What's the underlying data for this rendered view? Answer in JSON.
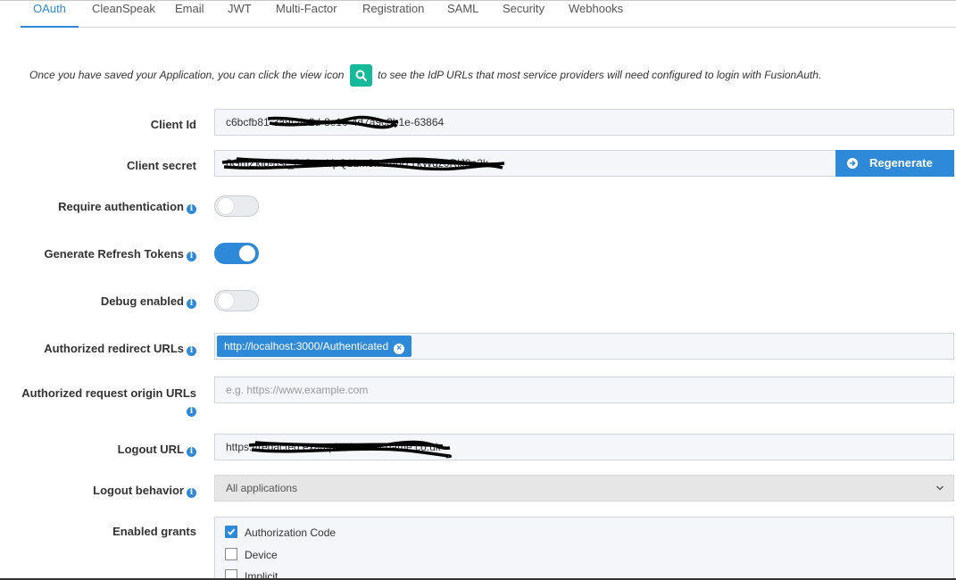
{
  "tabs": [
    "OAuth",
    "CleanSpeak",
    "Email",
    "JWT",
    "Multi-Factor",
    "Registration",
    "SAML",
    "Security",
    "Webhooks"
  ],
  "active_tab": "OAuth",
  "info": {
    "before": "Once you have saved your Application, you can click the view icon",
    "after": "to see the IdP URLs that most service providers will need configured to login with FusionAuth.",
    "icon": "search-icon"
  },
  "form": {
    "client_id": {
      "label": "Client Id",
      "value": "c6bcfb81-3a9f-4c2d-8e10-4d7a9c3b1e-63864"
    },
    "client_secret": {
      "label": "Client secret",
      "value": "6GmZklp-8sr_P-Sa-xYpQ1Lm3n4bVv7TkWqz0RiJ3n2k",
      "button": "Regenerate"
    },
    "require_auth": {
      "label": "Require authentication",
      "on": false
    },
    "refresh_tokens": {
      "label": "Generate Refresh Tokens",
      "on": true
    },
    "debug": {
      "label": "Debug enabled",
      "on": false
    },
    "redirect_urls": {
      "label": "Authorized redirect URLs",
      "chip": "http://localhost:3000/Authenticated"
    },
    "origin_urls": {
      "label": "Authorized request origin URLs",
      "placeholder": "e.g. https://www.example.com"
    },
    "logout_url": {
      "label": "Logout URL",
      "value": "https://redacted.example-domain-name.co.uk"
    },
    "logout_behavior": {
      "label": "Logout behavior",
      "selected": "All applications"
    },
    "grants": {
      "label": "Enabled grants",
      "items": [
        {
          "label": "Authorization Code",
          "checked": true
        },
        {
          "label": "Device",
          "checked": false
        },
        {
          "label": "Implicit",
          "checked": false
        }
      ]
    }
  },
  "colors": {
    "accent": "#2e8ad8",
    "view_icon": "#17b99b"
  }
}
